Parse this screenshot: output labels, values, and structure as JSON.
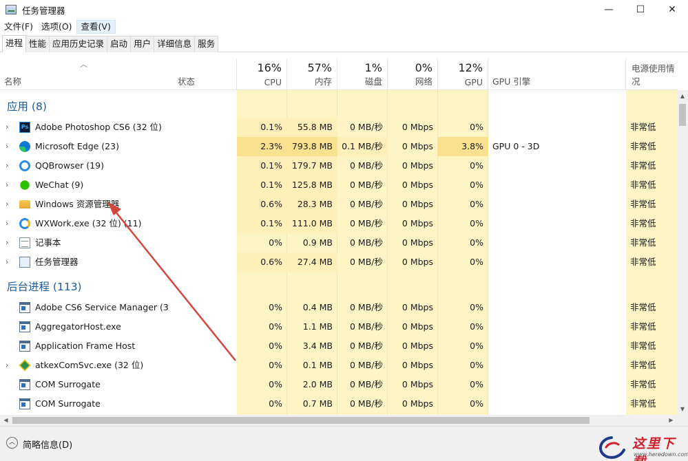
{
  "window": {
    "title": "任务管理器",
    "controls": {
      "minimize": "—",
      "maximize": "☐",
      "close": "✕"
    }
  },
  "menu": [
    {
      "label": "文件(F)"
    },
    {
      "label": "选项(O)"
    },
    {
      "label": "查看(V)"
    }
  ],
  "tabs": [
    {
      "label": "进程"
    },
    {
      "label": "性能"
    },
    {
      "label": "应用历史记录"
    },
    {
      "label": "启动"
    },
    {
      "label": "用户"
    },
    {
      "label": "详细信息"
    },
    {
      "label": "服务"
    }
  ],
  "columns": {
    "name": "名称",
    "status": "状态",
    "cpu": {
      "pct": "16%",
      "label": "CPU"
    },
    "memory": {
      "pct": "57%",
      "label": "内存"
    },
    "disk": {
      "pct": "1%",
      "label": "磁盘"
    },
    "network": {
      "pct": "0%",
      "label": "网络"
    },
    "gpu": {
      "pct": "12%",
      "label": "GPU"
    },
    "gpu_engine": "GPU 引擎",
    "power": "电源使用情况"
  },
  "groups": {
    "apps": "应用 (8)",
    "background": "后台进程 (113)"
  },
  "apps": [
    {
      "name": "Adobe Photoshop CS6 (32 位)",
      "cpu": "0.1%",
      "mem": "55.8 MB",
      "disk": "0 MB/秒",
      "net": "0 Mbps",
      "gpu": "0%",
      "engine": "",
      "power": "非常低"
    },
    {
      "name": "Microsoft Edge (23)",
      "cpu": "2.3%",
      "mem": "793.8 MB",
      "disk": "0.1 MB/秒",
      "net": "0 Mbps",
      "gpu": "3.8%",
      "engine": "GPU 0 - 3D",
      "power": "非常低"
    },
    {
      "name": "QQBrowser (19)",
      "cpu": "0.1%",
      "mem": "179.7 MB",
      "disk": "0 MB/秒",
      "net": "0 Mbps",
      "gpu": "0%",
      "engine": "",
      "power": "非常低"
    },
    {
      "name": "WeChat (9)",
      "cpu": "0.1%",
      "mem": "125.8 MB",
      "disk": "0 MB/秒",
      "net": "0 Mbps",
      "gpu": "0%",
      "engine": "",
      "power": "非常低"
    },
    {
      "name": "Windows 资源管理器",
      "cpu": "0.6%",
      "mem": "28.3 MB",
      "disk": "0 MB/秒",
      "net": "0 Mbps",
      "gpu": "0%",
      "engine": "",
      "power": "非常低"
    },
    {
      "name": "WXWork.exe (32 位) (11)",
      "cpu": "0.1%",
      "mem": "111.0 MB",
      "disk": "0 MB/秒",
      "net": "0 Mbps",
      "gpu": "0%",
      "engine": "",
      "power": "非常低"
    },
    {
      "name": "记事本",
      "cpu": "0%",
      "mem": "0.9 MB",
      "disk": "0 MB/秒",
      "net": "0 Mbps",
      "gpu": "0%",
      "engine": "",
      "power": "非常低"
    },
    {
      "name": "任务管理器",
      "cpu": "0.6%",
      "mem": "27.4 MB",
      "disk": "0 MB/秒",
      "net": "0 Mbps",
      "gpu": "0%",
      "engine": "",
      "power": "非常低"
    }
  ],
  "background": [
    {
      "name": "Adobe CS6 Service Manager (3...",
      "cpu": "0%",
      "mem": "0.4 MB",
      "disk": "0 MB/秒",
      "net": "0 Mbps",
      "gpu": "0%",
      "engine": "",
      "power": "非常低"
    },
    {
      "name": "AggregatorHost.exe",
      "cpu": "0%",
      "mem": "1.1 MB",
      "disk": "0 MB/秒",
      "net": "0 Mbps",
      "gpu": "0%",
      "engine": "",
      "power": "非常低"
    },
    {
      "name": "Application Frame Host",
      "cpu": "0%",
      "mem": "3.4 MB",
      "disk": "0 MB/秒",
      "net": "0 Mbps",
      "gpu": "0%",
      "engine": "",
      "power": "非常低"
    },
    {
      "name": "atkexComSvc.exe (32 位)",
      "cpu": "0%",
      "mem": "0.1 MB",
      "disk": "0 MB/秒",
      "net": "0 Mbps",
      "gpu": "0%",
      "engine": "",
      "power": "非常低"
    },
    {
      "name": "COM Surrogate",
      "cpu": "0%",
      "mem": "2.0 MB",
      "disk": "0 MB/秒",
      "net": "0 Mbps",
      "gpu": "0%",
      "engine": "",
      "power": "非常低"
    },
    {
      "name": "COM Surrogate",
      "cpu": "0%",
      "mem": "0.7 MB",
      "disk": "0 MB/秒",
      "net": "0 Mbps",
      "gpu": "0%",
      "engine": "",
      "power": "非常低"
    }
  ],
  "footer": {
    "fewer_details": "简略信息(D)"
  },
  "watermark": {
    "text": "这里下载",
    "sub": "www.heredown.com"
  },
  "colors": {
    "heat_light": "#fff4c4",
    "heat_medium": "#ffe8a8",
    "heat_strong": "#f9e28f",
    "group_title": "#1e5b9b",
    "arrow": "#d4463a"
  }
}
